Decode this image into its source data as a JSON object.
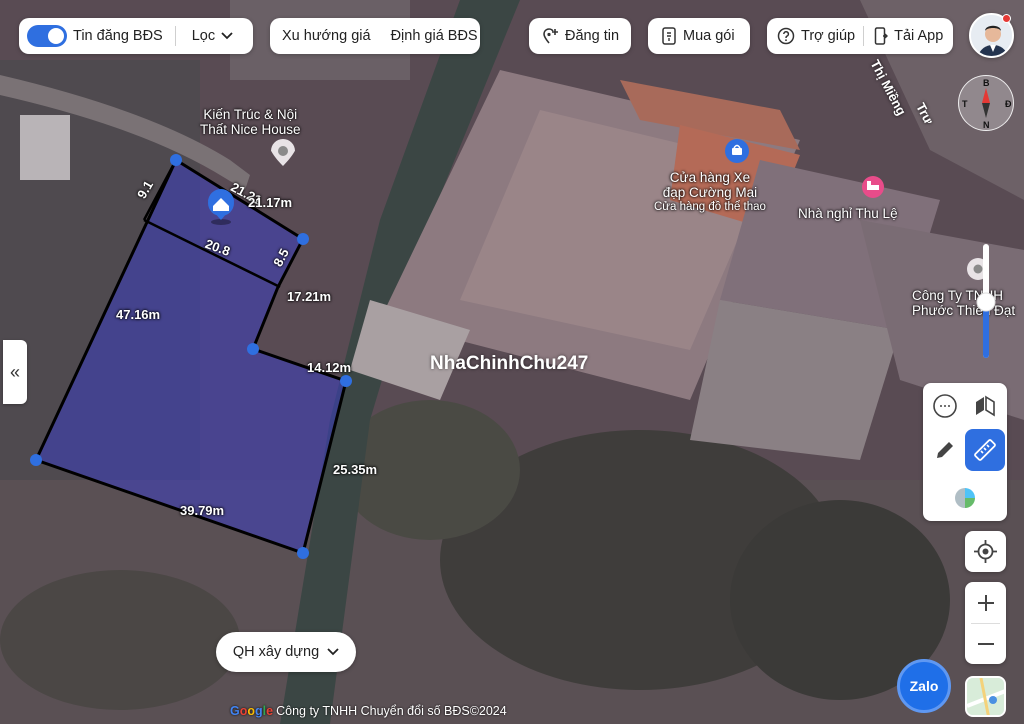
{
  "topbar": {
    "listing_toggle_label": "Tin đăng BĐS",
    "filter_label": "Lọc",
    "price_trend_label": "Xu hướng giá",
    "valuation_label": "Định giá BĐS",
    "post_label": "Đăng tin",
    "buy_package_label": "Mua gói",
    "help_label": "Trợ giúp",
    "download_app_label": "Tải App"
  },
  "compass": {
    "north": "B",
    "south": "N",
    "west": "T",
    "east": "Đ"
  },
  "map": {
    "watermark": "NhaChinhChu247",
    "road_name": "Thị Miềng",
    "road_fragment": "Trư",
    "pois": [
      {
        "line1": "Kiến Trúc & Nội",
        "line2": "Thất Nice House"
      },
      {
        "line1": "Cửa hàng Xe",
        "line2": "đạp Cường Mai",
        "line3": "Cửa hàng đồ thể thao"
      },
      {
        "line1": "Nhà nghỉ Thu Lệ"
      },
      {
        "line1": "Công Ty TNHH",
        "line2": "Phước Thiên Đạt"
      }
    ],
    "measurements": [
      "9.1",
      "21.21",
      "21.17m",
      "20.8",
      "8.5",
      "17.21m",
      "47.16m",
      "14.12m",
      "25.35m",
      "39.79m"
    ]
  },
  "zoning_button_label": "QH xây dựng",
  "footer": {
    "google": "Google",
    "attribution": "Công ty TNHH Chuyển đổi số BĐS©2024"
  },
  "zalo_label": "Zalo",
  "colors": {
    "accent": "#2f6fe0",
    "polygon_fill": "#3c3dc8",
    "vertex": "#2f6fe0"
  }
}
